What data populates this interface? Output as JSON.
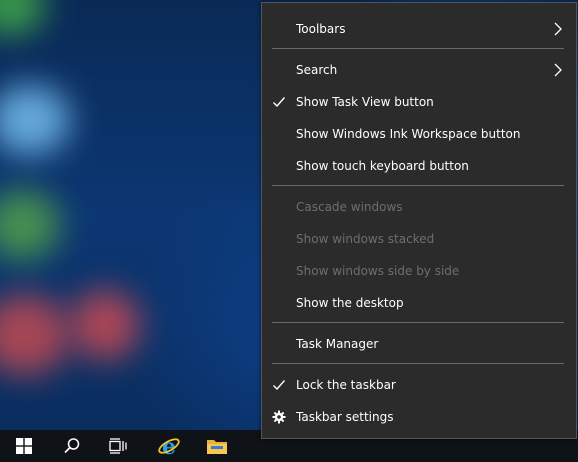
{
  "desktop": {},
  "taskbar": {
    "items": [
      {
        "name": "start",
        "icon": "windows-logo-icon"
      },
      {
        "name": "search",
        "icon": "search-icon"
      },
      {
        "name": "task-view",
        "icon": "task-view-icon"
      },
      {
        "name": "internet-explorer",
        "icon": "internet-explorer-icon"
      },
      {
        "name": "file-explorer",
        "icon": "folder-icon"
      }
    ]
  },
  "menu": {
    "colors": {
      "background": "#2b2b2b",
      "text": "#ffffff",
      "disabled_text": "#6e6e6e",
      "separator": "#6a6a6a"
    },
    "items": [
      {
        "label": "Toolbars",
        "submenu": true
      },
      {
        "label": "Search",
        "submenu": true
      },
      {
        "label": "Show Task View button",
        "checked": true
      },
      {
        "label": "Show Windows Ink Workspace button"
      },
      {
        "label": "Show touch keyboard button"
      },
      {
        "label": "Cascade windows",
        "disabled": true
      },
      {
        "label": "Show windows stacked",
        "disabled": true
      },
      {
        "label": "Show windows side by side",
        "disabled": true
      },
      {
        "label": "Show the desktop"
      },
      {
        "label": "Task Manager"
      },
      {
        "label": "Lock the taskbar",
        "checked": true
      },
      {
        "label": "Taskbar settings",
        "icon": "gear-icon"
      }
    ]
  }
}
